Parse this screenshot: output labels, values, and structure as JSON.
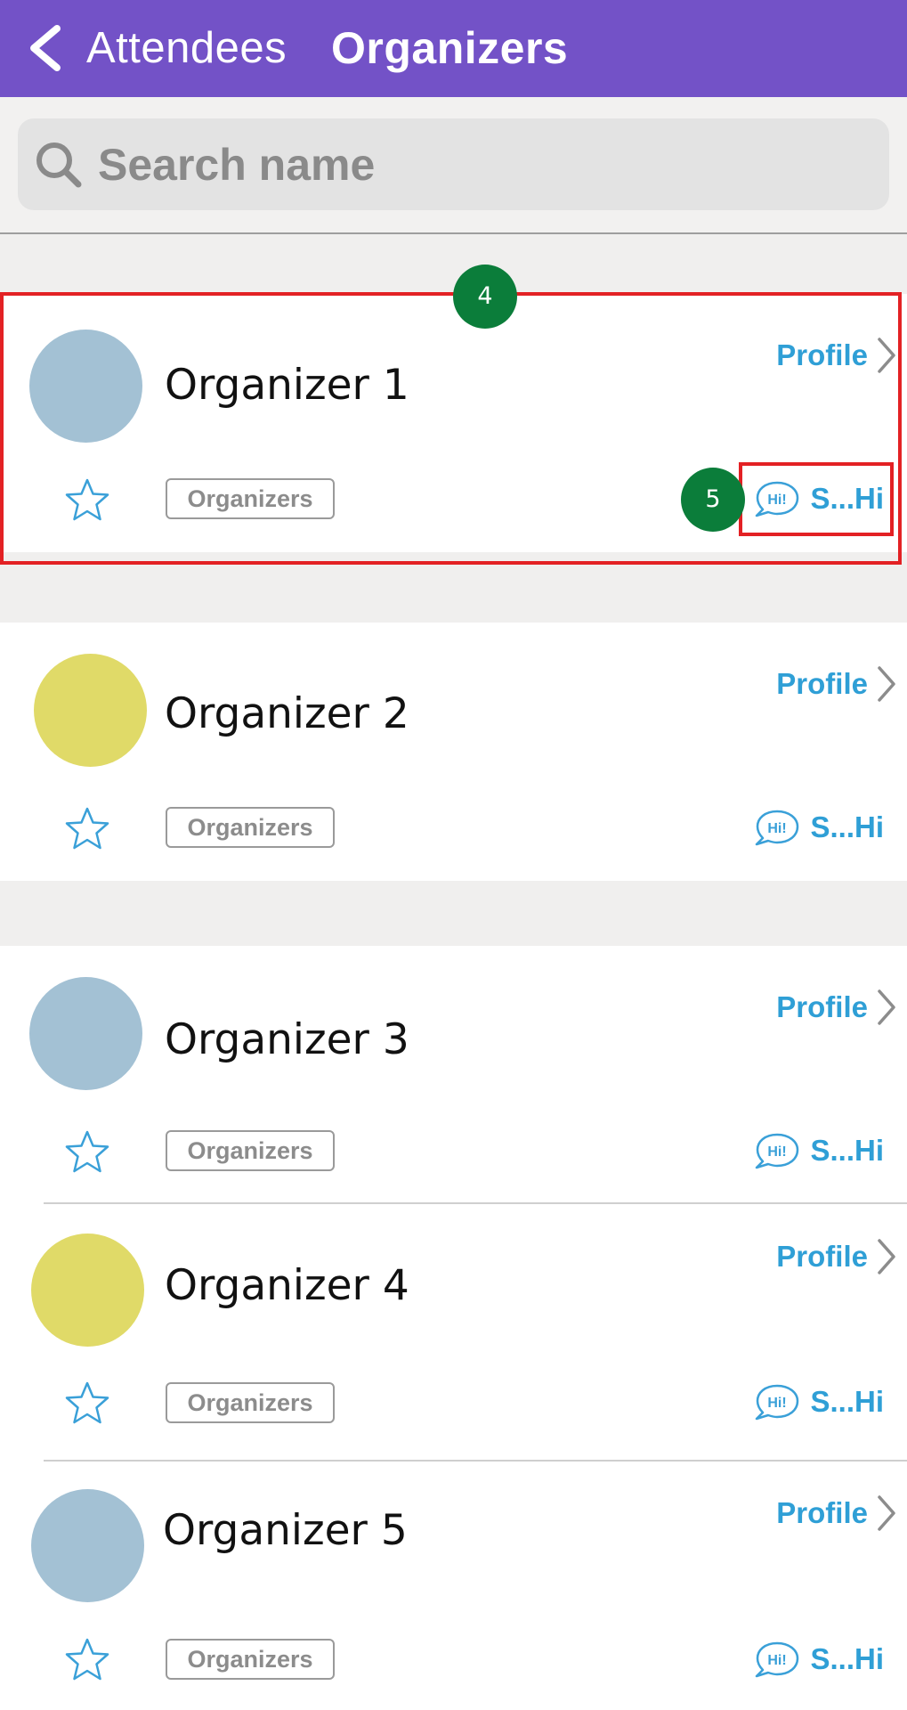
{
  "header": {
    "back_icon": "chevron-left-icon",
    "tabs": [
      {
        "label": "Attendees",
        "active": false
      },
      {
        "label": "Organizers",
        "active": true
      }
    ],
    "background": "#7352c7"
  },
  "search": {
    "placeholder": "Search name",
    "value": "",
    "icon": "search-icon"
  },
  "list": {
    "organizers": [
      {
        "name": "Organizer 1",
        "avatar_color": "#a3c1d4",
        "tag": "Organizers",
        "profile_label": "Profile",
        "sayhi_label": "S...Hi"
      },
      {
        "name": "Organizer 2",
        "avatar_color": "#e0da68",
        "tag": "Organizers",
        "profile_label": "Profile",
        "sayhi_label": "S...Hi"
      },
      {
        "name": "Organizer 3",
        "avatar_color": "#a3c1d4",
        "tag": "Organizers",
        "profile_label": "Profile",
        "sayhi_label": "S...Hi"
      },
      {
        "name": "Organizer 4",
        "avatar_color": "#e0da68",
        "tag": "Organizers",
        "profile_label": "Profile",
        "sayhi_label": "S...Hi"
      },
      {
        "name": "Organizer 5",
        "avatar_color": "#a3c1d4",
        "tag": "Organizers",
        "profile_label": "Profile",
        "sayhi_label": "S...Hi"
      }
    ],
    "star_icon": "star-outline-icon",
    "hi_icon": "hi-bubble-icon",
    "accent": "#2f9fd6"
  },
  "annotations": {
    "steps": [
      {
        "number": "4",
        "target": "organizer-card"
      },
      {
        "number": "5",
        "target": "say-hi-button"
      }
    ],
    "highlight_color": "#e32124",
    "badge_color": "#0b7d3a"
  }
}
